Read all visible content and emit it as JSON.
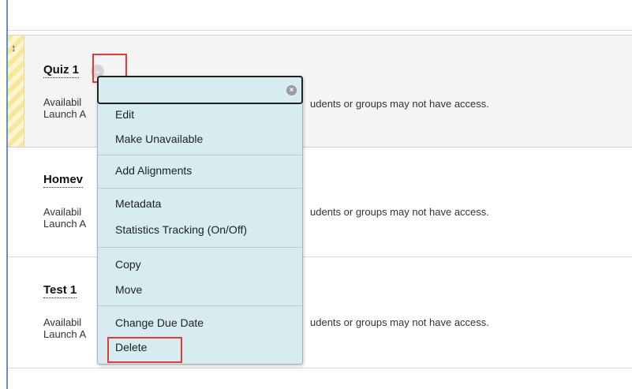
{
  "items": [
    {
      "title": "Quiz 1",
      "meta_line1": "Availabil",
      "meta_line2": "Launch A",
      "note": "udents or groups may not have access."
    },
    {
      "title": "Homev",
      "meta_line1": "Availabil",
      "meta_line2": "Launch A",
      "note": "udents or groups may not have access."
    },
    {
      "title": "Test 1",
      "meta_line1": "Availabil",
      "meta_line2": "Launch A",
      "note": "udents or groups may not have access."
    }
  ],
  "menu": {
    "groups": [
      [
        "Edit",
        "Make Unavailable"
      ],
      [
        "Add Alignments"
      ],
      [
        "Metadata",
        "Statistics Tracking (On/Off)"
      ],
      [
        "Copy",
        "Move"
      ],
      [
        "Change Due Date",
        "Delete"
      ]
    ],
    "edit": "Edit",
    "make_unavailable": "Make Unavailable",
    "add_alignments": "Add Alignments",
    "metadata": "Metadata",
    "statistics_tracking": "Statistics Tracking (On/Off)",
    "copy": "Copy",
    "move": "Move",
    "change_due_date": "Change Due Date",
    "delete": "Delete"
  },
  "icons": {
    "drag_handle": "↕",
    "chevron": "⌄",
    "close": "×"
  },
  "colors": {
    "highlight": "#e53935",
    "menu_bg": "#d7ecf1",
    "frame_accent": "#6a8bd6"
  }
}
